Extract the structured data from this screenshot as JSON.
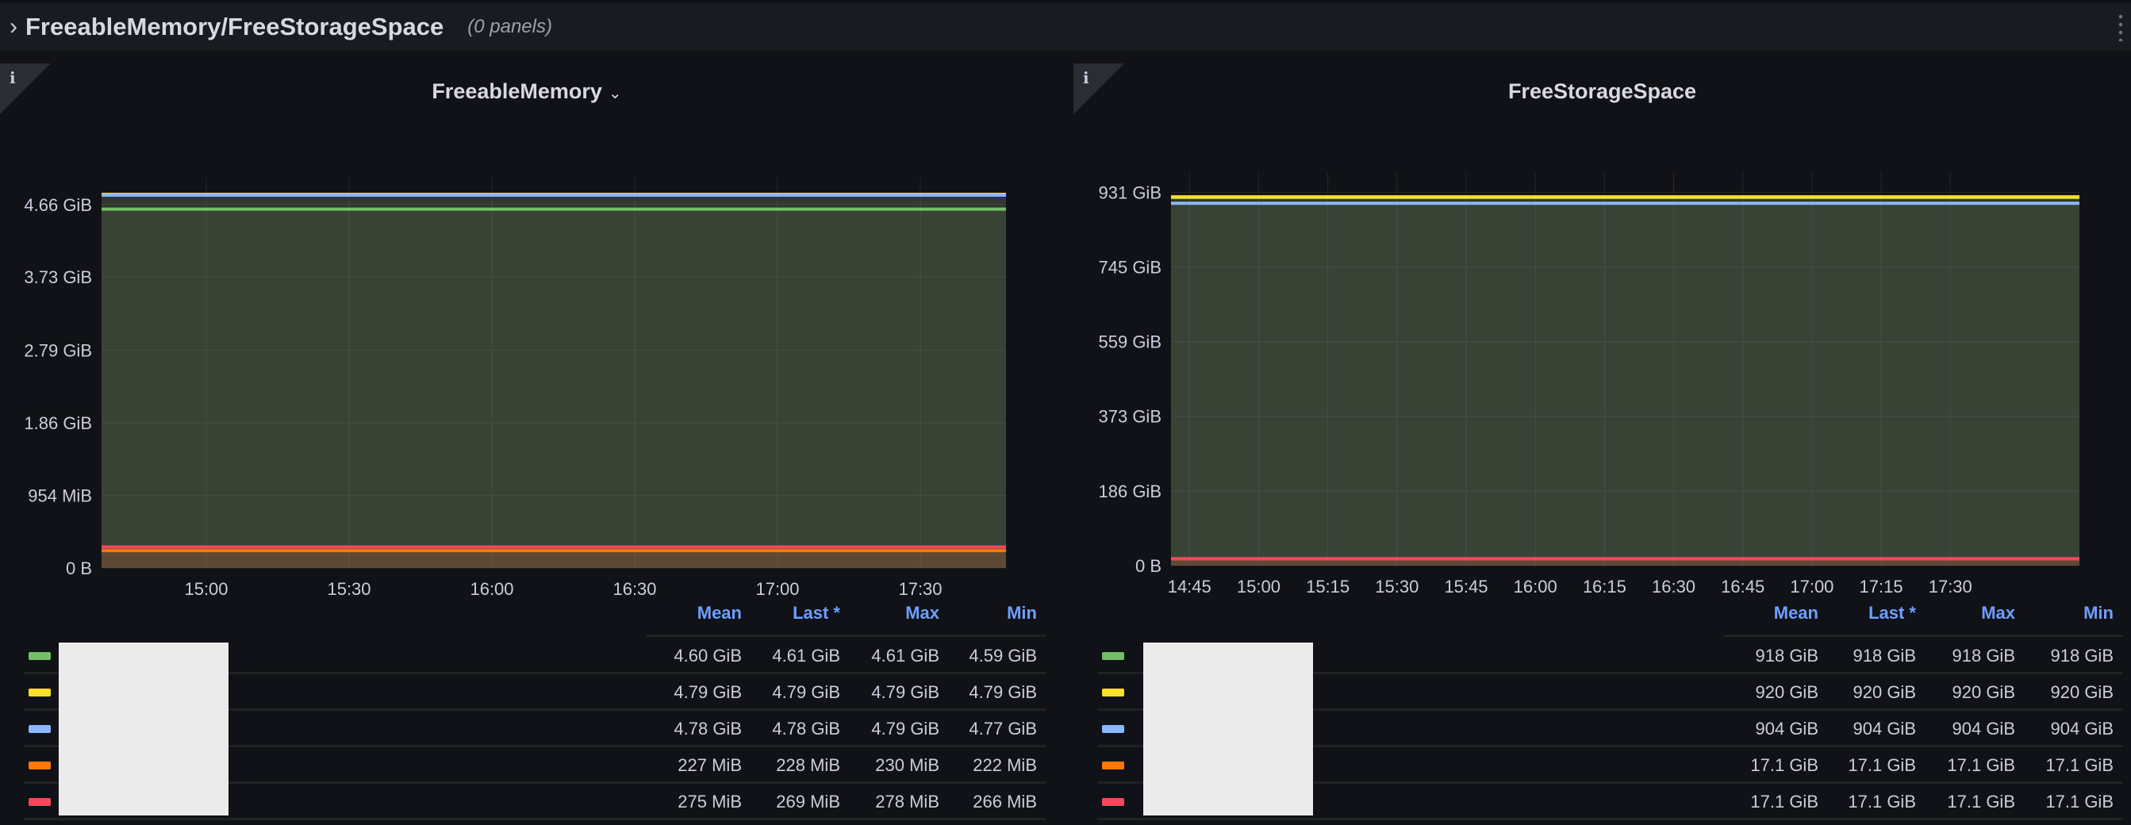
{
  "row": {
    "title": "FreeableMemory/FreeStorageSpace",
    "count": "(0 panels)"
  },
  "columns": [
    "Mean",
    "Last *",
    "Max",
    "Min"
  ],
  "panels": [
    {
      "title": "FreeableMemory",
      "info": "i",
      "caret": "⌄",
      "rows": [
        {
          "color": "#73bf69",
          "values": [
            "4.60 GiB",
            "4.61 GiB",
            "4.61 GiB",
            "4.59 GiB"
          ]
        },
        {
          "color": "#fade2a",
          "values": [
            "4.79 GiB",
            "4.79 GiB",
            "4.79 GiB",
            "4.79 GiB"
          ]
        },
        {
          "color": "#8ab8ff",
          "values": [
            "4.78 GiB",
            "4.78 GiB",
            "4.79 GiB",
            "4.77 GiB"
          ]
        },
        {
          "color": "#ff780a",
          "values": [
            "227 MiB",
            "228 MiB",
            "230 MiB",
            "222 MiB"
          ]
        },
        {
          "color": "#f2495c",
          "values": [
            "275 MiB",
            "269 MiB",
            "278 MiB",
            "266 MiB"
          ]
        }
      ]
    },
    {
      "title": "FreeStorageSpace",
      "info": "i",
      "caret": "",
      "rows": [
        {
          "color": "#73bf69",
          "values": [
            "918 GiB",
            "918 GiB",
            "918 GiB",
            "918 GiB"
          ]
        },
        {
          "color": "#fade2a",
          "values": [
            "920 GiB",
            "920 GiB",
            "920 GiB",
            "920 GiB"
          ]
        },
        {
          "color": "#8ab8ff",
          "values": [
            "904 GiB",
            "904 GiB",
            "904 GiB",
            "904 GiB"
          ]
        },
        {
          "color": "#ff780a",
          "values": [
            "17.1 GiB",
            "17.1 GiB",
            "17.1 GiB",
            "17.1 GiB"
          ]
        },
        {
          "color": "#f2495c",
          "values": [
            "17.1 GiB",
            "17.1 GiB",
            "17.1 GiB",
            "17.1 GiB"
          ]
        }
      ]
    }
  ],
  "chart_data": [
    {
      "type": "line",
      "title": "FreeableMemory",
      "yunit": "GiB",
      "ylim": [
        0,
        4.8
      ],
      "yticks": [
        {
          "v": 0,
          "label": "0 B"
        },
        {
          "v": 0.932,
          "label": "954 MiB"
        },
        {
          "v": 1.86,
          "label": "1.86 GiB"
        },
        {
          "v": 2.79,
          "label": "2.79 GiB"
        },
        {
          "v": 3.73,
          "label": "3.73 GiB"
        },
        {
          "v": 4.66,
          "label": "4.66 GiB"
        }
      ],
      "xrange_min": [
        878,
        1068
      ],
      "xticks": [
        {
          "v": 900,
          "label": "15:00"
        },
        {
          "v": 930,
          "label": "15:30"
        },
        {
          "v": 960,
          "label": "16:00"
        },
        {
          "v": 990,
          "label": "16:30"
        },
        {
          "v": 1020,
          "label": "17:00"
        },
        {
          "v": 1050,
          "label": "17:30"
        }
      ],
      "series": [
        {
          "color": "#73bf69",
          "value": 4.6
        },
        {
          "color": "#fade2a",
          "value": 4.79
        },
        {
          "color": "#8ab8ff",
          "value": 4.78
        },
        {
          "color": "#ff780a",
          "value": 0.222
        },
        {
          "color": "#f2495c",
          "value": 0.269
        }
      ]
    },
    {
      "type": "line",
      "title": "FreeStorageSpace",
      "yunit": "GiB",
      "ylim": [
        0,
        940
      ],
      "yticks": [
        {
          "v": 0,
          "label": "0 B"
        },
        {
          "v": 186,
          "label": "186 GiB"
        },
        {
          "v": 373,
          "label": "373 GiB"
        },
        {
          "v": 559,
          "label": "559 GiB"
        },
        {
          "v": 745,
          "label": "745 GiB"
        },
        {
          "v": 931,
          "label": "931 GiB"
        }
      ],
      "xrange_min": [
        881,
        1078
      ],
      "xticks": [
        {
          "v": 885,
          "label": "14:45"
        },
        {
          "v": 900,
          "label": "15:00"
        },
        {
          "v": 915,
          "label": "15:15"
        },
        {
          "v": 930,
          "label": "15:30"
        },
        {
          "v": 945,
          "label": "15:45"
        },
        {
          "v": 960,
          "label": "16:00"
        },
        {
          "v": 975,
          "label": "16:15"
        },
        {
          "v": 990,
          "label": "16:30"
        },
        {
          "v": 1005,
          "label": "16:45"
        },
        {
          "v": 1020,
          "label": "17:00"
        },
        {
          "v": 1035,
          "label": "17:15"
        },
        {
          "v": 1050,
          "label": "17:30"
        }
      ],
      "series": [
        {
          "color": "#73bf69",
          "value": 918
        },
        {
          "color": "#fade2a",
          "value": 920
        },
        {
          "color": "#8ab8ff",
          "value": 904
        },
        {
          "color": "#ff780a",
          "value": 17.1
        },
        {
          "color": "#f2495c",
          "value": 17.1
        }
      ]
    }
  ]
}
